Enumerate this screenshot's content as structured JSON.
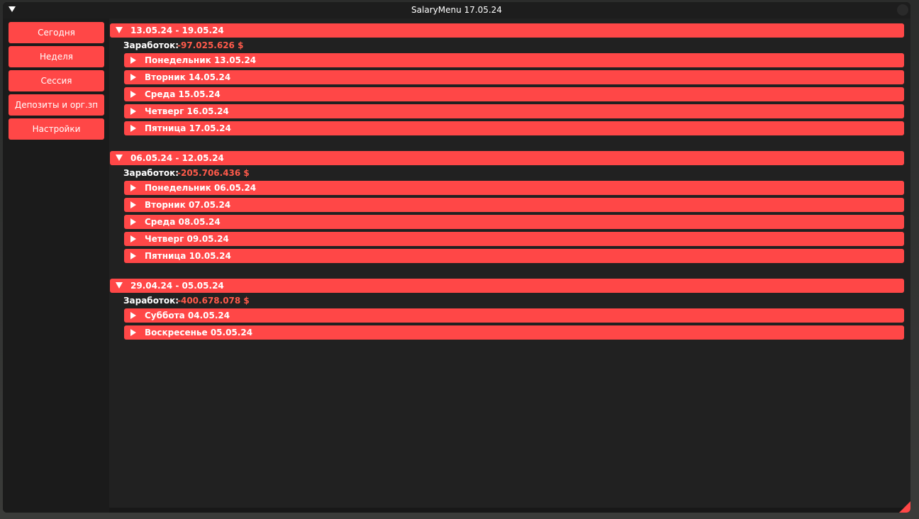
{
  "window": {
    "title": "SalaryMenu 17.05.24"
  },
  "sidebar": {
    "items": [
      {
        "label": "Сегодня"
      },
      {
        "label": "Неделя"
      },
      {
        "label": "Сессия"
      },
      {
        "label": "Депозиты и орг.зп"
      },
      {
        "label": "Настройки"
      }
    ]
  },
  "weeks": [
    {
      "label": "13.05.24 - 19.05.24",
      "earnings_label": "Заработок:",
      "earnings_value": "-97.025.626 $",
      "days": [
        {
          "label": "Понедельник 13.05.24"
        },
        {
          "label": "Вторник 14.05.24"
        },
        {
          "label": "Среда 15.05.24"
        },
        {
          "label": "Четверг 16.05.24"
        },
        {
          "label": "Пятница 17.05.24"
        }
      ]
    },
    {
      "label": "06.05.24 - 12.05.24",
      "earnings_label": "Заработок:",
      "earnings_value": "-205.706.436 $",
      "days": [
        {
          "label": "Понедельник 06.05.24"
        },
        {
          "label": "Вторник 07.05.24"
        },
        {
          "label": "Среда 08.05.24"
        },
        {
          "label": "Четверг 09.05.24"
        },
        {
          "label": "Пятница 10.05.24"
        }
      ]
    },
    {
      "label": "29.04.24 - 05.05.24",
      "earnings_label": "Заработок:",
      "earnings_value": "-400.678.078 $",
      "days": [
        {
          "label": "Суббота 04.05.24"
        },
        {
          "label": "Воскресенье 05.05.24"
        }
      ]
    }
  ],
  "colors": {
    "accent": "#ff4747",
    "negative_value": "#ff5a4a",
    "window_bg": "#181818",
    "content_bg": "#212121"
  },
  "icons": {
    "collapse": "triangle-down-icon",
    "expand": "triangle-right-icon"
  }
}
